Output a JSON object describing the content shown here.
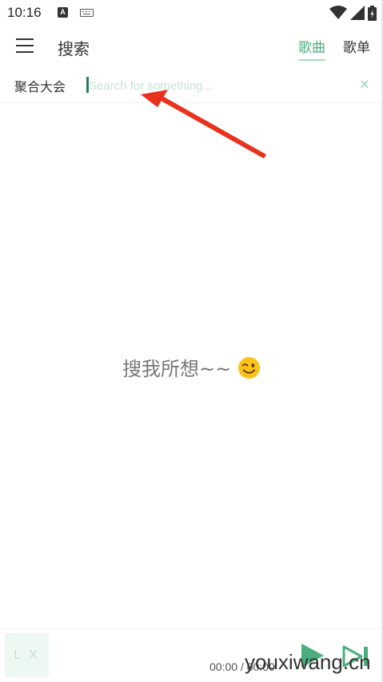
{
  "status_bar": {
    "time": "10:16",
    "a_icon_letter": "A"
  },
  "header": {
    "title": "搜索",
    "tabs": [
      {
        "label": "歌曲",
        "active": true
      },
      {
        "label": "歌单",
        "active": false
      }
    ]
  },
  "search": {
    "source": "聚合大会",
    "placeholder": "Search for something...",
    "value": ""
  },
  "empty_state": {
    "text": "搜我所想~~"
  },
  "player": {
    "cover_text": "L X",
    "time": "00:00 / 00:00"
  },
  "watermark": "youxiwang.cn",
  "colors": {
    "accent": "#4cae7f",
    "placeholder": "#c7e2d4",
    "arrow": "#e8321e"
  },
  "icons": {
    "menu": "menu-icon",
    "clear": "close-icon",
    "play": "play-icon",
    "next": "skip-next-icon",
    "emoji": "wink-emoji-icon"
  }
}
